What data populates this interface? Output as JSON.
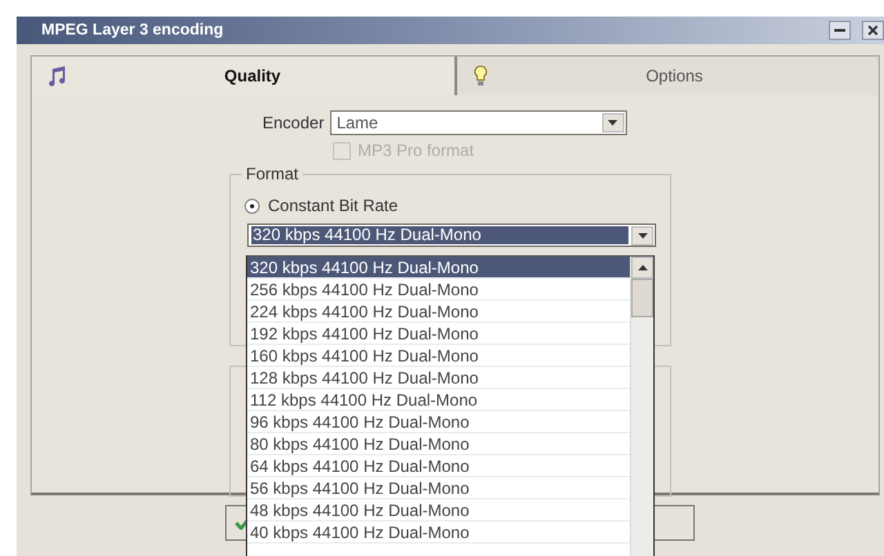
{
  "window": {
    "title": "MPEG Layer 3 encoding"
  },
  "tabs": [
    {
      "label": "Quality",
      "selected": true
    },
    {
      "label": "Options",
      "selected": false
    }
  ],
  "encoder": {
    "label": "Encoder",
    "value": "Lame"
  },
  "mp3pro": {
    "label": "MP3 Pro format",
    "checked": false,
    "disabled": true
  },
  "format": {
    "title": "Format",
    "radio": {
      "label": "Constant Bit Rate",
      "selected": true
    },
    "bitrate": {
      "value": "320 kbps 44100 Hz Dual-Mono",
      "options": [
        {
          "label": "320 kbps 44100 Hz Dual-Mono",
          "selected": true
        },
        {
          "label": "256 kbps 44100 Hz Dual-Mono",
          "selected": false
        },
        {
          "label": "224 kbps 44100 Hz Dual-Mono",
          "selected": false
        },
        {
          "label": "192 kbps 44100 Hz Dual-Mono",
          "selected": false
        },
        {
          "label": "160 kbps 44100 Hz Dual-Mono",
          "selected": false
        },
        {
          "label": "128 kbps 44100 Hz Dual-Mono",
          "selected": false
        },
        {
          "label": "112 kbps 44100 Hz Dual-Mono",
          "selected": false
        },
        {
          "label": "96 kbps 44100 Hz Dual-Mono",
          "selected": false
        },
        {
          "label": "80 kbps 44100 Hz Dual-Mono",
          "selected": false
        },
        {
          "label": "64 kbps 44100 Hz Dual-Mono",
          "selected": false
        },
        {
          "label": "56 kbps 44100 Hz Dual-Mono",
          "selected": false
        },
        {
          "label": "48 kbps 44100 Hz Dual-Mono",
          "selected": false
        },
        {
          "label": "40 kbps 44100 Hz Dual-Mono",
          "selected": false
        }
      ]
    }
  }
}
